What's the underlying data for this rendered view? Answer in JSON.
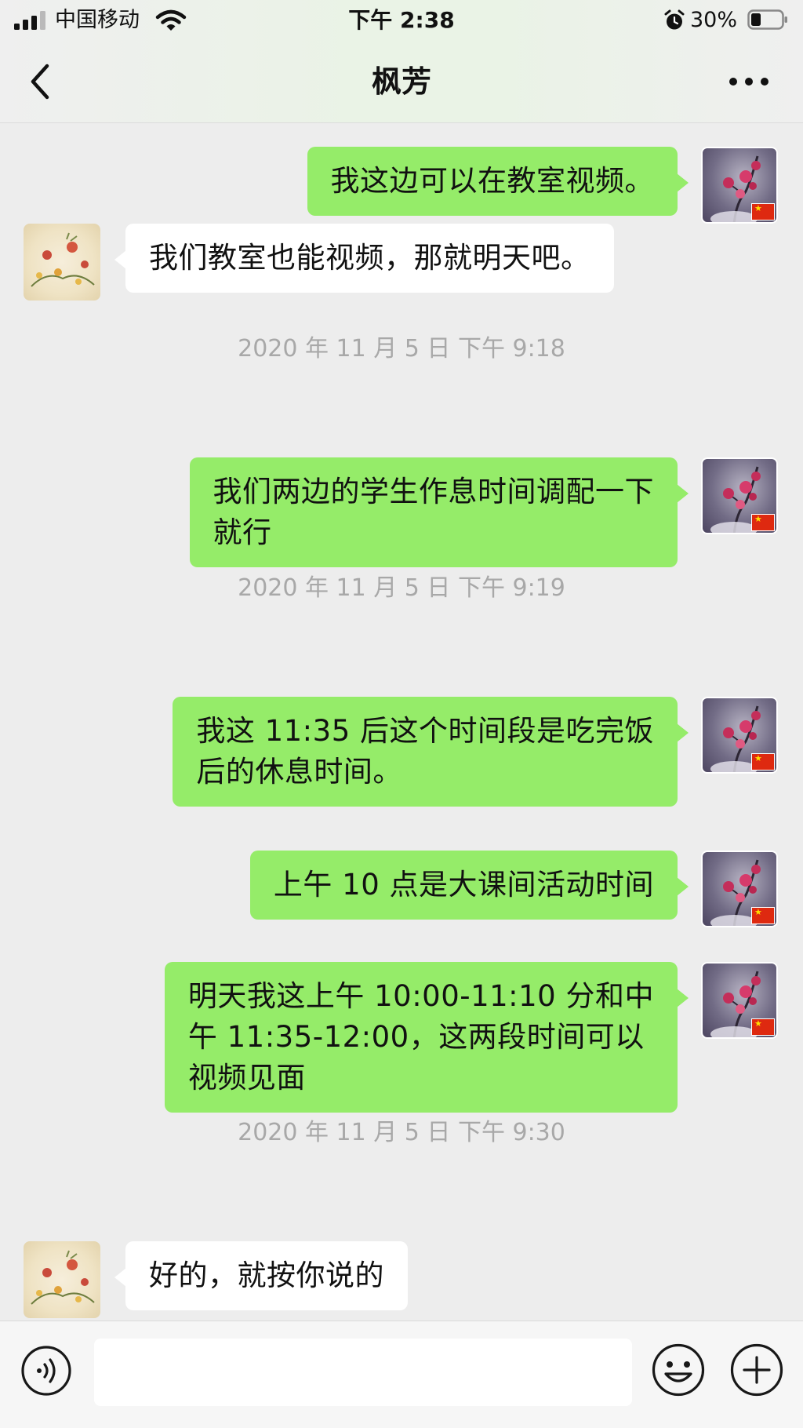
{
  "status_bar": {
    "carrier": "中国移动",
    "time": "下午 2:38",
    "battery": "30%",
    "icons": [
      "signal-icon",
      "wifi-icon",
      "alarm-icon",
      "battery-icon"
    ]
  },
  "header": {
    "title": "枫芳",
    "back_icon": "chevron-left-icon",
    "more_icon": "more-dots-icon"
  },
  "messages": [
    {
      "sender": "me",
      "text": "我这边可以在教室视频。"
    },
    {
      "sender": "them",
      "text": "我们教室也能视频，那就明天吧。"
    },
    {
      "timestamp": "2020 年 11 月 5 日  下午 9:18"
    },
    {
      "sender": "me",
      "text": "我们两边的学生作息时间调配一下\n就行"
    },
    {
      "timestamp": "2020 年 11 月 5 日  下午 9:19"
    },
    {
      "sender": "me",
      "text": "我这 11:35 后这个时间段是吃完饭\n后的休息时间。"
    },
    {
      "sender": "me",
      "text": "上午 10 点是大课间活动时间"
    },
    {
      "sender": "me",
      "text": "明天我这上午 10:00-11:10 分和中\n午 11:35-12:00，这两段时间可以\n视频见面"
    },
    {
      "timestamp": "2020 年 11 月 5 日  下午 9:30"
    },
    {
      "sender": "them",
      "text": "好的，就按你说的"
    }
  ],
  "input_bar": {
    "voice_icon": "voice-icon",
    "input_value": "",
    "emoji_icon": "emoji-icon",
    "plus_icon": "plus-icon"
  },
  "colors": {
    "my_bubble": "#95ec69",
    "their_bubble": "#ffffff",
    "background": "#ededed",
    "timestamp_text": "#a8a8a8"
  }
}
